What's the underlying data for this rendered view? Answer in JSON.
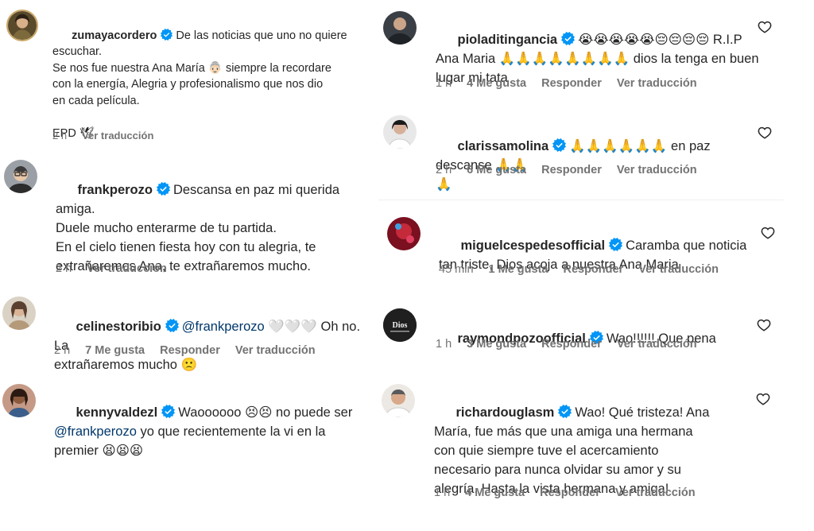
{
  "left": [
    {
      "username": "zumayacordero",
      "lines": [
        "De las noticias que uno no quiere",
        "escuchar.",
        "Se nos fue nuestra Ana María 👵🏻 siempre la recordare",
        "con la energía, Alegria y profesionalismo que nos dio",
        "en cada película.",
        "",
        "EPD 🕊"
      ],
      "time": "2 h",
      "translate": "Ver traducción"
    },
    {
      "username": "frankperozo",
      "lines": [
        "Descansa en paz mi querida",
        "amiga.",
        "Duele mucho enterarme de tu partida.",
        "En el cielo tienen fiesta hoy con tu alegria, te",
        "extrañaremos Ana, te extrañaremos mucho."
      ],
      "time": "2 h",
      "translate": "Ver traducción"
    },
    {
      "username": "celinestoribio",
      "mention": "@frankperozo",
      "lines": [
        "🤍🤍🤍 Oh no. La",
        "extrañaremos mucho 🙁"
      ],
      "time": "2 h",
      "likes": "7 Me gusta",
      "reply": "Responder",
      "translate": "Ver traducción"
    },
    {
      "username": "kennyvaldezl",
      "lines": [
        "Waoooooo 😣😣 no puede ser",
        "@frankperozo yo que recientemente la vi en la",
        "premier 😫😫😫"
      ],
      "mention": "@frankperozo"
    }
  ],
  "right": [
    {
      "username": "pioladitingancia",
      "lines": [
        "😭😭😭😭😭😔😔😔😔 R.I.P",
        "Ana Maria 🙏🙏🙏🙏🙏🙏🙏🙏 dios la tenga en buen",
        "lugar mi tata"
      ],
      "time": "1 h",
      "likes": "4 Me gusta",
      "reply": "Responder",
      "translate": "Ver traducción"
    },
    {
      "username": "clarissamolina",
      "lines": [
        "🙏🙏🙏🙏🙏🙏 en paz descanse 🙏🙏",
        "🙏"
      ],
      "time": "2 h",
      "likes": "6 Me gusta",
      "reply": "Responder",
      "translate": "Ver traducción"
    },
    {
      "username": "miguelcespedesofficial",
      "lines": [
        "Caramba que noticia",
        "tan triste, Dios acoja a nuestra Ana Maria"
      ],
      "time": "45 min",
      "likes": "1 Me gusta",
      "reply": "Responder",
      "translate": "Ver traducción"
    },
    {
      "username": "raymondpozoofficial",
      "lines": [
        "Wao!!!!!! Que pena"
      ],
      "time": "1 h",
      "likes": "3 Me gusta",
      "reply": "Responder",
      "translate": "Ver traducción",
      "avatar_text": "Dios"
    },
    {
      "username": "richardouglasm",
      "lines": [
        "Wao! Qué tristeza! Ana",
        "María, fue más que una amiga una hermana",
        "con quie siempre tuve el acercamiento",
        "necesario para nunca olvidar su amor y su",
        "alegría. Hasta la vista hermana y amiga!"
      ],
      "time": "1 h",
      "likes": "4 Me gusta",
      "reply": "Responder",
      "translate": "Ver traducción"
    }
  ],
  "colors": {
    "text": "#262626",
    "muted": "#737373",
    "verified": "#0095f6",
    "mention": "#00376b"
  },
  "icons": {
    "verified": "verified-badge-icon",
    "like": "heart-icon"
  }
}
